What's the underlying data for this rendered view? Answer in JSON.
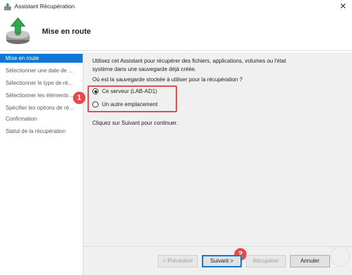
{
  "window": {
    "title": "Assistant Récupération",
    "close_glyph": "✕"
  },
  "header": {
    "title": "Mise en route"
  },
  "sidebar": {
    "items": [
      {
        "label": "Mise en route",
        "active": true
      },
      {
        "label": "Sélectionner une date de ..."
      },
      {
        "label": "Sélectionner le type de ré..."
      },
      {
        "label": "Sélectionner les éléments ..."
      },
      {
        "label": "Spécifier les options de ré..."
      },
      {
        "label": "Confirmation"
      },
      {
        "label": "Statut de la récupération"
      }
    ]
  },
  "main": {
    "intro": "Utilisez cet Assistant pour récupérer des fichiers, applications, volumes ou l'état système dans une sauvegarde déjà créée.",
    "question": "Où est la sauvegarde stockée à utiliser pour la récupération ?",
    "options": [
      {
        "label": "Ce serveur (LAB-AD1)",
        "checked": true
      },
      {
        "label": "Un autre emplacement",
        "checked": false
      }
    ],
    "hint": "Cliquez sur Suivant pour continuer."
  },
  "buttons": {
    "previous": "< Précédent",
    "next": "Suivant >",
    "recover": "Récupérer",
    "cancel": "Annuler"
  },
  "annotations": {
    "step1": "1",
    "step2": "2"
  },
  "colors": {
    "accent": "#0f78d7",
    "annotation": "#e24b4b"
  }
}
